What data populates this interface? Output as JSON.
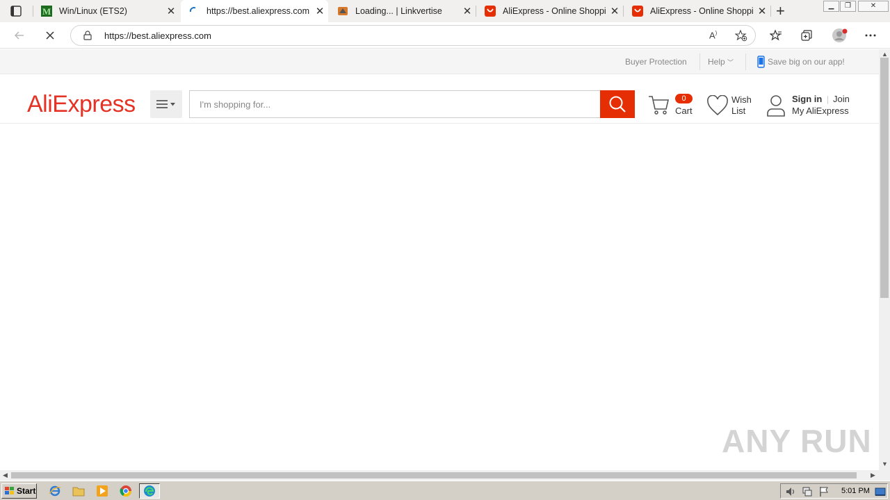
{
  "browser": {
    "tabs": [
      {
        "title": "Win/Linux (ETS2)",
        "icon": "mod-m-icon",
        "active": false
      },
      {
        "title": "https://best.aliexpress.com",
        "icon": "loading-spinner-icon",
        "active": true
      },
      {
        "title": "Loading... | Linkvertise",
        "icon": "linkvertise-icon",
        "active": false
      },
      {
        "title": "AliExpress - Online Shopping",
        "icon": "aliexpress-icon",
        "active": false
      },
      {
        "title": "AliExpress - Online Shopping",
        "icon": "aliexpress-icon",
        "active": false
      }
    ],
    "address": "https://best.aliexpress.com"
  },
  "page": {
    "topbar": {
      "buyer_protection": "Buyer Protection",
      "help": "Help",
      "app_promo": "Save big on our app!"
    },
    "header": {
      "logo": "AliExpress",
      "search_placeholder": "I'm shopping for...",
      "cart_count": "0",
      "cart_label": "Cart",
      "wish_line1": "Wish",
      "wish_line2": "List",
      "sign_in": "Sign in",
      "join": "Join",
      "my_account": "My AliExpress"
    }
  },
  "watermark": "ANY RUN",
  "taskbar": {
    "start": "Start",
    "clock": "5:01 PM"
  },
  "colors": {
    "brand_red": "#e62e04",
    "logo_red": "#e43225"
  }
}
